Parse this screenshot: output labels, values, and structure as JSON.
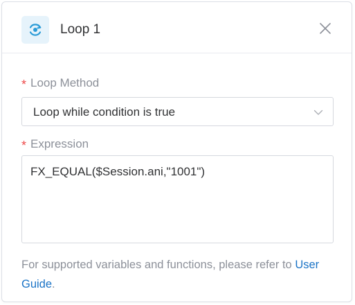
{
  "dialog": {
    "title": "Loop 1",
    "header_icon": "loop-icon",
    "close_icon": "close-icon"
  },
  "fields": {
    "loop_method": {
      "required_mark": "*",
      "label": "Loop Method",
      "value": "Loop while condition is true",
      "arrow_icon": "chevron-down-icon"
    },
    "expression": {
      "required_mark": "*",
      "label": "Expression",
      "value": "FX_EQUAL($Session.ani,\"1001\")"
    }
  },
  "hint": {
    "text": "For supported variables and functions, please refer to ",
    "link_text": "User Guide",
    "suffix": "."
  },
  "colors": {
    "accent": "#1a73c6",
    "required": "#ee4b4b",
    "icon_bg": "#e6f3fb",
    "icon_fg": "#2a9bd7"
  }
}
